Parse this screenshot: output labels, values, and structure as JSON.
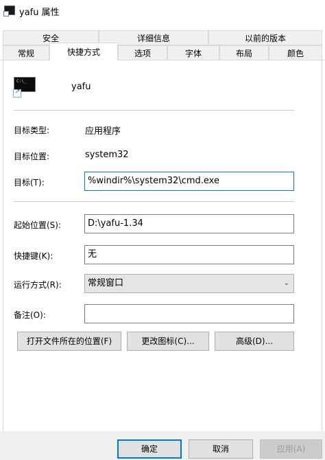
{
  "window": {
    "title": "yafu 属性"
  },
  "tabs": {
    "row1": [
      "安全",
      "详细信息",
      "以前的版本"
    ],
    "row2": [
      "常规",
      "快捷方式",
      "选项",
      "字体",
      "布局",
      "颜色"
    ],
    "active": "快捷方式"
  },
  "app": {
    "name": "yafu",
    "icon": "cmd-shortcut-icon"
  },
  "fields": {
    "target_type": {
      "label": "目标类型:",
      "value": "应用程序"
    },
    "target_location": {
      "label": "目标位置:",
      "value": "system32"
    },
    "target": {
      "label": "目标(T):",
      "value": "%windir%\\system32\\cmd.exe"
    },
    "start_in": {
      "label": "起始位置(S):",
      "value": "D:\\yafu-1.34"
    },
    "shortcut_key": {
      "label": "快捷键(K):",
      "value": "无"
    },
    "run": {
      "label": "运行方式(R):",
      "value": "常规窗口"
    },
    "comment": {
      "label": "备注(O):",
      "value": ""
    }
  },
  "buttons": {
    "open_location": "打开文件所在的位置(F)",
    "change_icon": "更改图标(C)...",
    "advanced": "高级(D)...",
    "ok": "确定",
    "cancel": "取消",
    "apply": "应用(A)"
  }
}
